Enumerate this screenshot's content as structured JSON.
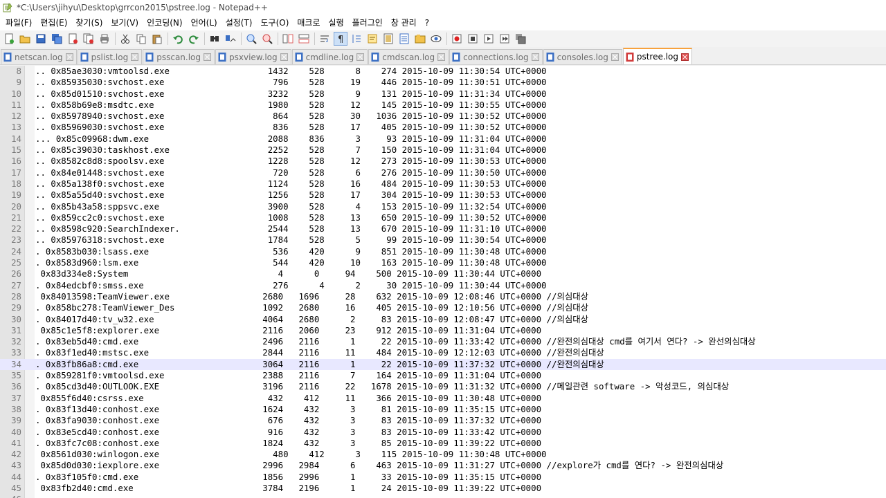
{
  "window": {
    "title": "*C:\\Users\\jihyu\\Desktop\\grrcon2015\\pstree.log - Notepad++"
  },
  "menu": [
    "파일(F)",
    "편집(E)",
    "찾기(S)",
    "보기(V)",
    "인코딩(N)",
    "언어(L)",
    "설정(T)",
    "도구(O)",
    "매크로",
    "실행",
    "플러그인",
    "창 관리",
    "?"
  ],
  "toolbar": {
    "icons": [
      "new-file-icon",
      "open-file-icon",
      "save-icon",
      "save-all-icon",
      "close-file-icon",
      "close-all-icon",
      "print-icon",
      "cut-icon",
      "copy-icon",
      "paste-icon",
      "undo-icon",
      "redo-icon",
      "find-icon",
      "replace-icon",
      "zoom-in-icon",
      "zoom-out-icon",
      "sync-vertical-icon",
      "sync-horizontal-icon",
      "word-wrap-icon",
      "show-all-chars-icon",
      "indent-guide-icon",
      "user-language-icon",
      "doc-map-icon",
      "function-list-icon",
      "folder-workspace-icon",
      "monitoring-icon",
      "record-macro-icon",
      "stop-macro-icon",
      "play-macro-icon",
      "play-multiple-icon",
      "save-macro-icon"
    ],
    "active_index": 19
  },
  "tabs": [
    {
      "label": "netscan.log",
      "active": false
    },
    {
      "label": "pslist.log",
      "active": false
    },
    {
      "label": "psscan.log",
      "active": false
    },
    {
      "label": "psxview.log",
      "active": false
    },
    {
      "label": "cmdline.log",
      "active": false
    },
    {
      "label": "cmdscan.log",
      "active": false
    },
    {
      "label": "connections.log",
      "active": false
    },
    {
      "label": "consoles.log",
      "active": false
    },
    {
      "label": "pstree.log",
      "active": true
    }
  ],
  "editor": {
    "current_line": 34,
    "lines": [
      {
        "n": "8",
        "text": ".. 0x85ae3030:vmtoolsd.exe                   1432    528      8    274 2015-10-09 11:30:54 UTC+0000"
      },
      {
        "n": "9",
        "text": ".. 0x85935030:svchost.exe                     796    528     19    446 2015-10-09 11:30:51 UTC+0000"
      },
      {
        "n": "10",
        "text": ".. 0x85d01510:svchost.exe                    3232    528      9    131 2015-10-09 11:31:34 UTC+0000"
      },
      {
        "n": "11",
        "text": ".. 0x858b69e8:msdtc.exe                      1980    528     12    145 2015-10-09 11:30:55 UTC+0000"
      },
      {
        "n": "12",
        "text": ".. 0x85978940:svchost.exe                     864    528     30   1036 2015-10-09 11:30:52 UTC+0000"
      },
      {
        "n": "13",
        "text": ".. 0x85969030:svchost.exe                     836    528     17    405 2015-10-09 11:30:52 UTC+0000"
      },
      {
        "n": "14",
        "text": "... 0x85c09968:dwm.exe                       2088    836      3     93 2015-10-09 11:31:04 UTC+0000"
      },
      {
        "n": "15",
        "text": ".. 0x85c39030:taskhost.exe                   2252    528      7    150 2015-10-09 11:31:04 UTC+0000"
      },
      {
        "n": "16",
        "text": ".. 0x8582c8d8:spoolsv.exe                    1228    528     12    273 2015-10-09 11:30:53 UTC+0000"
      },
      {
        "n": "17",
        "text": ".. 0x84e01448:svchost.exe                     720    528      6    276 2015-10-09 11:30:50 UTC+0000"
      },
      {
        "n": "18",
        "text": ".. 0x85a138f0:svchost.exe                    1124    528     16    484 2015-10-09 11:30:53 UTC+0000"
      },
      {
        "n": "19",
        "text": ".. 0x85a55d40:svchost.exe                    1256    528     17    304 2015-10-09 11:30:53 UTC+0000"
      },
      {
        "n": "20",
        "text": ".. 0x85b43a58:sppsvc.exe                     3900    528      4    153 2015-10-09 11:32:54 UTC+0000"
      },
      {
        "n": "21",
        "text": ".. 0x859cc2c0:svchost.exe                    1008    528     13    650 2015-10-09 11:30:52 UTC+0000"
      },
      {
        "n": "22",
        "text": ".. 0x8598c920:SearchIndexer.                 2544    528     13    670 2015-10-09 11:31:10 UTC+0000"
      },
      {
        "n": "23",
        "text": ".. 0x85976318:svchost.exe                    1784    528      5     99 2015-10-09 11:30:54 UTC+0000"
      },
      {
        "n": "24",
        "text": ". 0x8583b030:lsass.exe                        536    420      9    851 2015-10-09 11:30:48 UTC+0000"
      },
      {
        "n": "25",
        "text": ". 0x8583d960:lsm.exe                          544    420     10    163 2015-10-09 11:30:48 UTC+0000"
      },
      {
        "n": "26",
        "text": " 0x83d334e8:System                             4      0     94    500 2015-10-09 11:30:44 UTC+0000"
      },
      {
        "n": "27",
        "text": ". 0x84edcbf0:smss.exe                         276      4      2     30 2015-10-09 11:30:44 UTC+0000"
      },
      {
        "n": "28",
        "text": " 0x84013598:TeamViewer.exe                  2680   1696     28    632 2015-10-09 12:08:46 UTC+0000 //의심대상"
      },
      {
        "n": "29",
        "text": ". 0x858bc278:TeamViewer_Des                 1092   2680     16    405 2015-10-09 12:10:56 UTC+0000 //의심대상"
      },
      {
        "n": "30",
        "text": ". 0x84017d40:tv_w32.exe                     4064   2680      2     83 2015-10-09 12:08:47 UTC+0000 //의심대상"
      },
      {
        "n": "31",
        "text": " 0x85c1e5f8:explorer.exe                    2116   2060     23    912 2015-10-09 11:31:04 UTC+0000"
      },
      {
        "n": "32",
        "text": ". 0x83eb5d40:cmd.exe                        2496   2116      1     22 2015-10-09 11:33:42 UTC+0000 //완전의심대상 cmd를 여기서 연다? -> 완선의심대상"
      },
      {
        "n": "33",
        "text": ". 0x83f1ed40:mstsc.exe                      2844   2116     11    484 2015-10-09 12:12:03 UTC+0000 //완전의심대상"
      },
      {
        "n": "34",
        "text": ". 0x83fb86a8:cmd.exe                        3064   2116      1     22 2015-10-09 11:37:32 UTC+0000 //완전의심대상"
      },
      {
        "n": "35",
        "text": ". 0x859281f0:vmtoolsd.exe                   2388   2116      7    164 2015-10-09 11:31:04 UTC+0000"
      },
      {
        "n": "36",
        "text": ". 0x85cd3d40:OUTLOOK.EXE                    3196   2116     22   1678 2015-10-09 11:31:32 UTC+0000 //메일관련 software -> 악성코드, 의심대상"
      },
      {
        "n": "37",
        "text": " 0x855f6d40:csrss.exe                        432    412     11    366 2015-10-09 11:30:48 UTC+0000"
      },
      {
        "n": "38",
        "text": ". 0x83f13d40:conhost.exe                    1624    432      3     81 2015-10-09 11:35:15 UTC+0000"
      },
      {
        "n": "39",
        "text": ". 0x83fa9030:conhost.exe                     676    432      3     83 2015-10-09 11:37:32 UTC+0000"
      },
      {
        "n": "40",
        "text": ". 0x83e5cd40:conhost.exe                     916    432      3     83 2015-10-09 11:33:42 UTC+0000"
      },
      {
        "n": "41",
        "text": ". 0x83fc7c08:conhost.exe                    1824    432      3     85 2015-10-09 11:39:22 UTC+0000"
      },
      {
        "n": "42",
        "text": " 0x8561d030:winlogon.exe                      480    412      3    115 2015-10-09 11:30:48 UTC+0000"
      },
      {
        "n": "43",
        "text": " 0x85d0d030:iexplore.exe                    2996   2984      6    463 2015-10-09 11:31:27 UTC+0000 //explore가 cmd를 연다? -> 완전의심대상"
      },
      {
        "n": "44",
        "text": ". 0x83f105f0:cmd.exe                        1856   2996      1     33 2015-10-09 11:35:15 UTC+0000"
      },
      {
        "n": "45",
        "text": " 0x83fb2d40:cmd.exe                         3784   2196      1     24 2015-10-09 11:39:22 UTC+0000"
      },
      {
        "n": "46",
        "text": ""
      }
    ]
  }
}
